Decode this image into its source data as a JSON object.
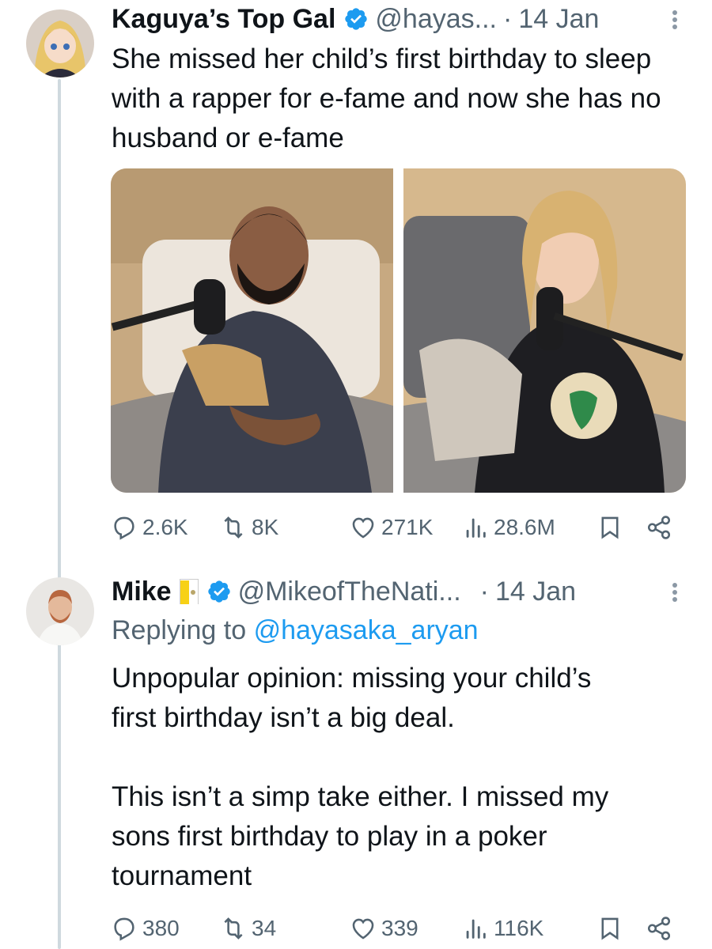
{
  "tweets": [
    {
      "name": "Kaguya’s Top Gal",
      "handle": "@hayas...",
      "separator": "·",
      "date": "14 Jan",
      "text": "She missed her child’s first birthday to sleep with a rapper for e-fame and now she has no husband or e-fame",
      "media": [
        "photo-man-in-bed",
        "photo-woman-in-bed"
      ],
      "stats": {
        "replies": "2.6K",
        "reposts": "8K",
        "likes": "271K",
        "views": "28.6M"
      }
    },
    {
      "name": "Mike",
      "handle": "@MikeofTheNati...",
      "separator": "·",
      "date": "14 Jan",
      "replying_prefix": "Replying to",
      "replying_to": "@hayasaka_aryan",
      "text": "Unpopular opinion: missing your child’s\nfirst birthday isn’t a big deal.\n\nThis isn’t a simp take either. I missed my\nsons first birthday to play in a poker\ntournament",
      "stats": {
        "replies": "380",
        "reposts": "34",
        "likes": "339",
        "views": "116K"
      }
    }
  ],
  "icons": [
    "reply-icon",
    "repost-icon",
    "like-icon",
    "views-icon",
    "bookmark-icon",
    "share-icon",
    "verified-badge-icon",
    "more-options-icon",
    "flag-icon"
  ],
  "colors": {
    "accent": "#1d9bf0",
    "muted": "#536471",
    "thread_line": "#cfd9de"
  }
}
